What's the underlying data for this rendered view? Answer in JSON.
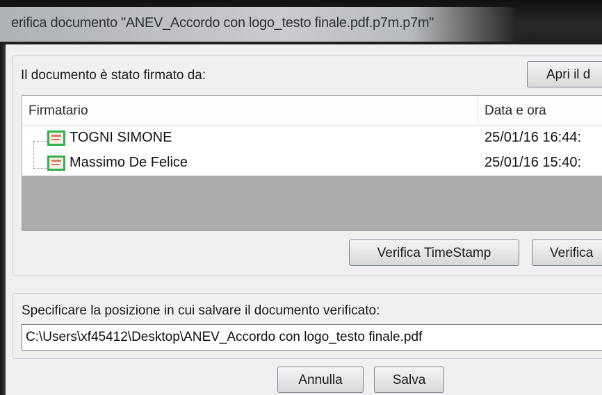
{
  "window": {
    "title": "erifica documento \"ANEV_Accordo con logo_testo finale.pdf.p7m.p7m\""
  },
  "signers": {
    "label": "Il documento è stato firmato da:",
    "open_button": "Apri il d",
    "columns": {
      "signer": "Firmatario",
      "datetime": "Data e ora"
    },
    "rows": [
      {
        "name": "TOGNI SIMONE",
        "datetime": "25/01/16 16:44:",
        "icon": "certificate-icon"
      },
      {
        "name": "Massimo De Felice",
        "datetime": "25/01/16 15:40:",
        "icon": "certificate-icon"
      }
    ],
    "verify_timestamp_button": "Verifica TimeStamp",
    "verify_button": "Verifica"
  },
  "save": {
    "label": "Specificare la posizione in cui salvare il documento verificato:",
    "path": "C:\\Users\\xf45412\\Desktop\\ANEV_Accordo con logo_testo finale.pdf"
  },
  "footer": {
    "cancel": "Annulla",
    "save": "Salva"
  },
  "colors": {
    "certificate_border": "#2fb24a",
    "list_background": "#ababab"
  }
}
